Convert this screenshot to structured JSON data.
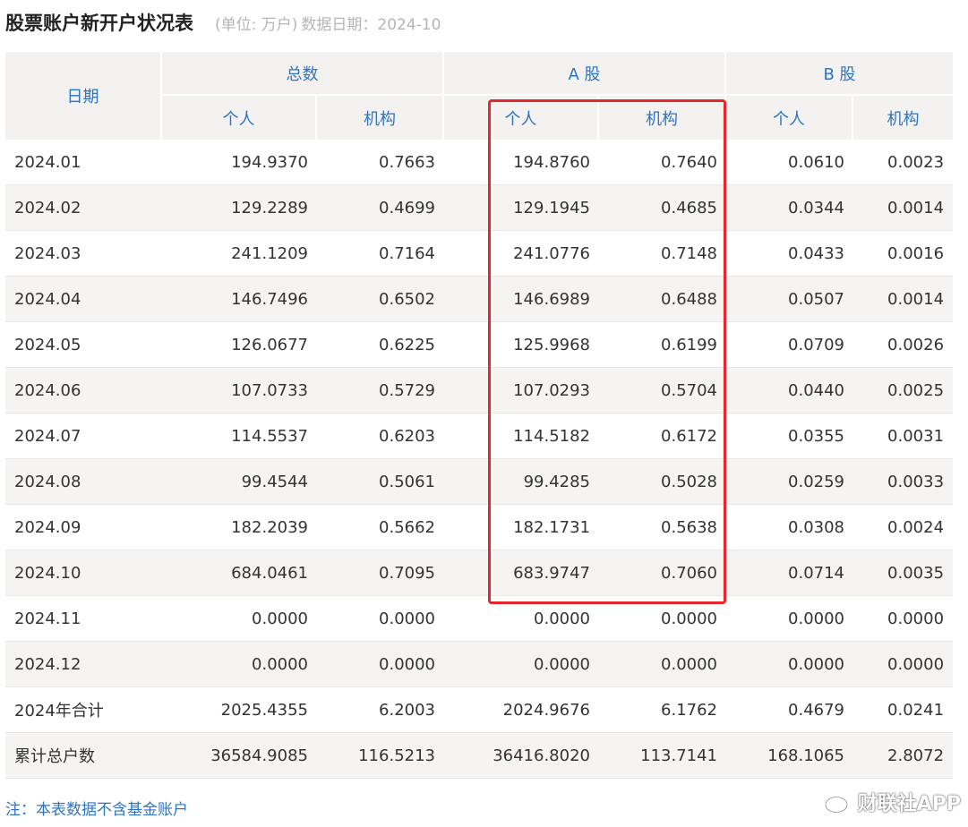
{
  "header": {
    "title": "股票账户新开户状况表",
    "unit": "(单位: 万户)",
    "date_label": "数据日期：",
    "date_value": "2024-10"
  },
  "table": {
    "col_date": "日期",
    "group_total": "总数",
    "group_a": "A 股",
    "group_b": "B 股",
    "sub_individual": "个人",
    "sub_institution": "机构",
    "rows": [
      {
        "date": "2024.01",
        "total_ind": "194.9370",
        "total_inst": "0.7663",
        "a_ind": "194.8760",
        "a_inst": "0.7640",
        "b_ind": "0.0610",
        "b_inst": "0.0023"
      },
      {
        "date": "2024.02",
        "total_ind": "129.2289",
        "total_inst": "0.4699",
        "a_ind": "129.1945",
        "a_inst": "0.4685",
        "b_ind": "0.0344",
        "b_inst": "0.0014"
      },
      {
        "date": "2024.03",
        "total_ind": "241.1209",
        "total_inst": "0.7164",
        "a_ind": "241.0776",
        "a_inst": "0.7148",
        "b_ind": "0.0433",
        "b_inst": "0.0016"
      },
      {
        "date": "2024.04",
        "total_ind": "146.7496",
        "total_inst": "0.6502",
        "a_ind": "146.6989",
        "a_inst": "0.6488",
        "b_ind": "0.0507",
        "b_inst": "0.0014"
      },
      {
        "date": "2024.05",
        "total_ind": "126.0677",
        "total_inst": "0.6225",
        "a_ind": "125.9968",
        "a_inst": "0.6199",
        "b_ind": "0.0709",
        "b_inst": "0.0026"
      },
      {
        "date": "2024.06",
        "total_ind": "107.0733",
        "total_inst": "0.5729",
        "a_ind": "107.0293",
        "a_inst": "0.5704",
        "b_ind": "0.0440",
        "b_inst": "0.0025"
      },
      {
        "date": "2024.07",
        "total_ind": "114.5537",
        "total_inst": "0.6203",
        "a_ind": "114.5182",
        "a_inst": "0.6172",
        "b_ind": "0.0355",
        "b_inst": "0.0031"
      },
      {
        "date": "2024.08",
        "total_ind": "99.4544",
        "total_inst": "0.5061",
        "a_ind": "99.4285",
        "a_inst": "0.5028",
        "b_ind": "0.0259",
        "b_inst": "0.0033"
      },
      {
        "date": "2024.09",
        "total_ind": "182.2039",
        "total_inst": "0.5662",
        "a_ind": "182.1731",
        "a_inst": "0.5638",
        "b_ind": "0.0308",
        "b_inst": "0.0024"
      },
      {
        "date": "2024.10",
        "total_ind": "684.0461",
        "total_inst": "0.7095",
        "a_ind": "683.9747",
        "a_inst": "0.7060",
        "b_ind": "0.0714",
        "b_inst": "0.0035"
      },
      {
        "date": "2024.11",
        "total_ind": "0.0000",
        "total_inst": "0.0000",
        "a_ind": "0.0000",
        "a_inst": "0.0000",
        "b_ind": "0.0000",
        "b_inst": "0.0000"
      },
      {
        "date": "2024.12",
        "total_ind": "0.0000",
        "total_inst": "0.0000",
        "a_ind": "0.0000",
        "a_inst": "0.0000",
        "b_ind": "0.0000",
        "b_inst": "0.0000"
      },
      {
        "date": "2024年合计",
        "total_ind": "2025.4355",
        "total_inst": "6.2003",
        "a_ind": "2024.9676",
        "a_inst": "6.1762",
        "b_ind": "0.4679",
        "b_inst": "0.0241"
      },
      {
        "date": "累计总户数",
        "total_ind": "36584.9085",
        "total_inst": "116.5213",
        "a_ind": "36416.8020",
        "a_inst": "113.7141",
        "b_ind": "168.1065",
        "b_inst": "2.8072"
      }
    ]
  },
  "highlight": {
    "color": "#e8262b"
  },
  "footer": {
    "note": "注：本表数据不含基金账户",
    "watermark": "财联社APP",
    "watermark_icon": "weibo-icon"
  },
  "colors": {
    "header_text": "#2f74c0",
    "header_bg": "#f3f2f1",
    "stripe_bg": "#f5f4f3"
  }
}
